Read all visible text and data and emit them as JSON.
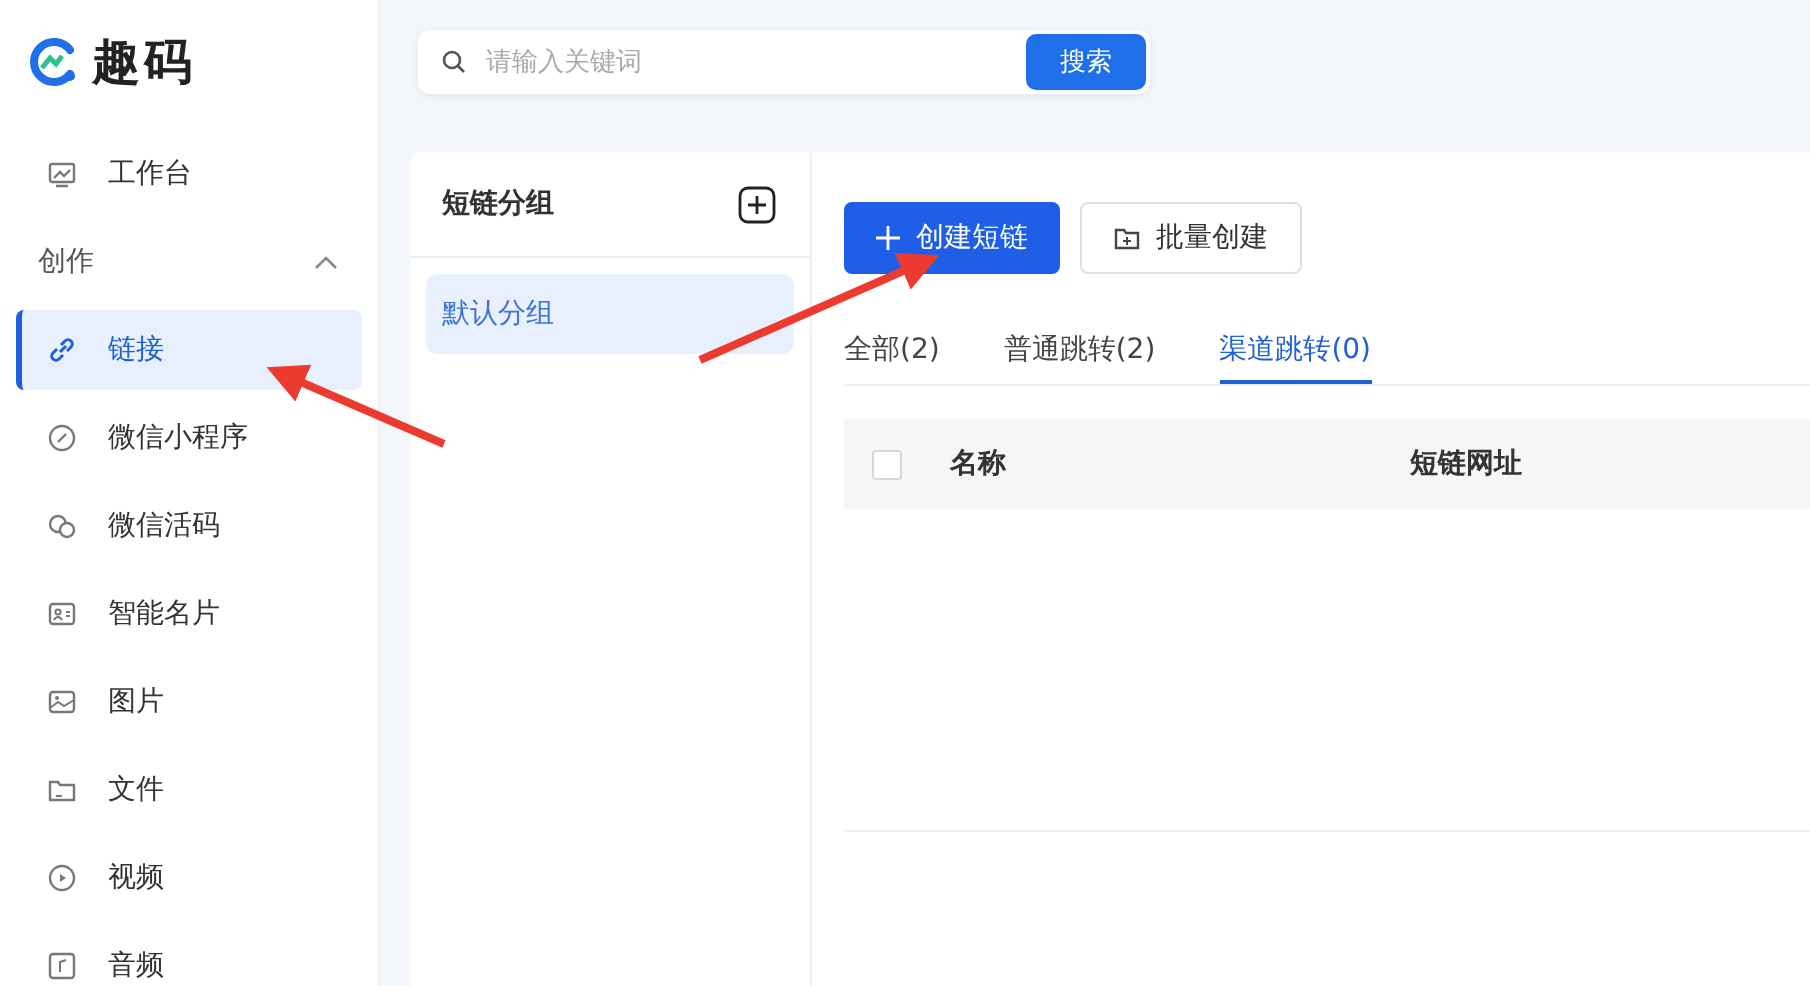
{
  "brand": {
    "name": "趣码"
  },
  "sidebar": {
    "items": [
      {
        "kind": "item",
        "label": "工作台",
        "selected": false
      },
      {
        "kind": "section",
        "label": "创作",
        "expanded": true
      },
      {
        "kind": "item",
        "label": "链接",
        "selected": true
      },
      {
        "kind": "item",
        "label": "微信小程序",
        "selected": false
      },
      {
        "kind": "item",
        "label": "微信活码",
        "selected": false
      },
      {
        "kind": "item",
        "label": "智能名片",
        "selected": false
      },
      {
        "kind": "item",
        "label": "图片",
        "selected": false
      },
      {
        "kind": "item",
        "label": "文件",
        "selected": false
      },
      {
        "kind": "item",
        "label": "视频",
        "selected": false
      },
      {
        "kind": "item",
        "label": "音频",
        "selected": false
      }
    ]
  },
  "search": {
    "placeholder": "请输入关键词",
    "button": "搜索"
  },
  "groups": {
    "title": "短链分组",
    "items": [
      {
        "label": "默认分组",
        "selected": true
      }
    ]
  },
  "actions": [
    {
      "kind": "primary",
      "label": "创建短链"
    },
    {
      "kind": "secondary",
      "label": "批量创建"
    }
  ],
  "tabs": [
    {
      "label": "全部(2)",
      "selected": false
    },
    {
      "label": "普通跳转(2)",
      "selected": false
    },
    {
      "label": "渠道跳转(0)",
      "selected": true
    }
  ],
  "table": {
    "all_checked": false,
    "columns": [
      "名称",
      "短链网址"
    ]
  }
}
